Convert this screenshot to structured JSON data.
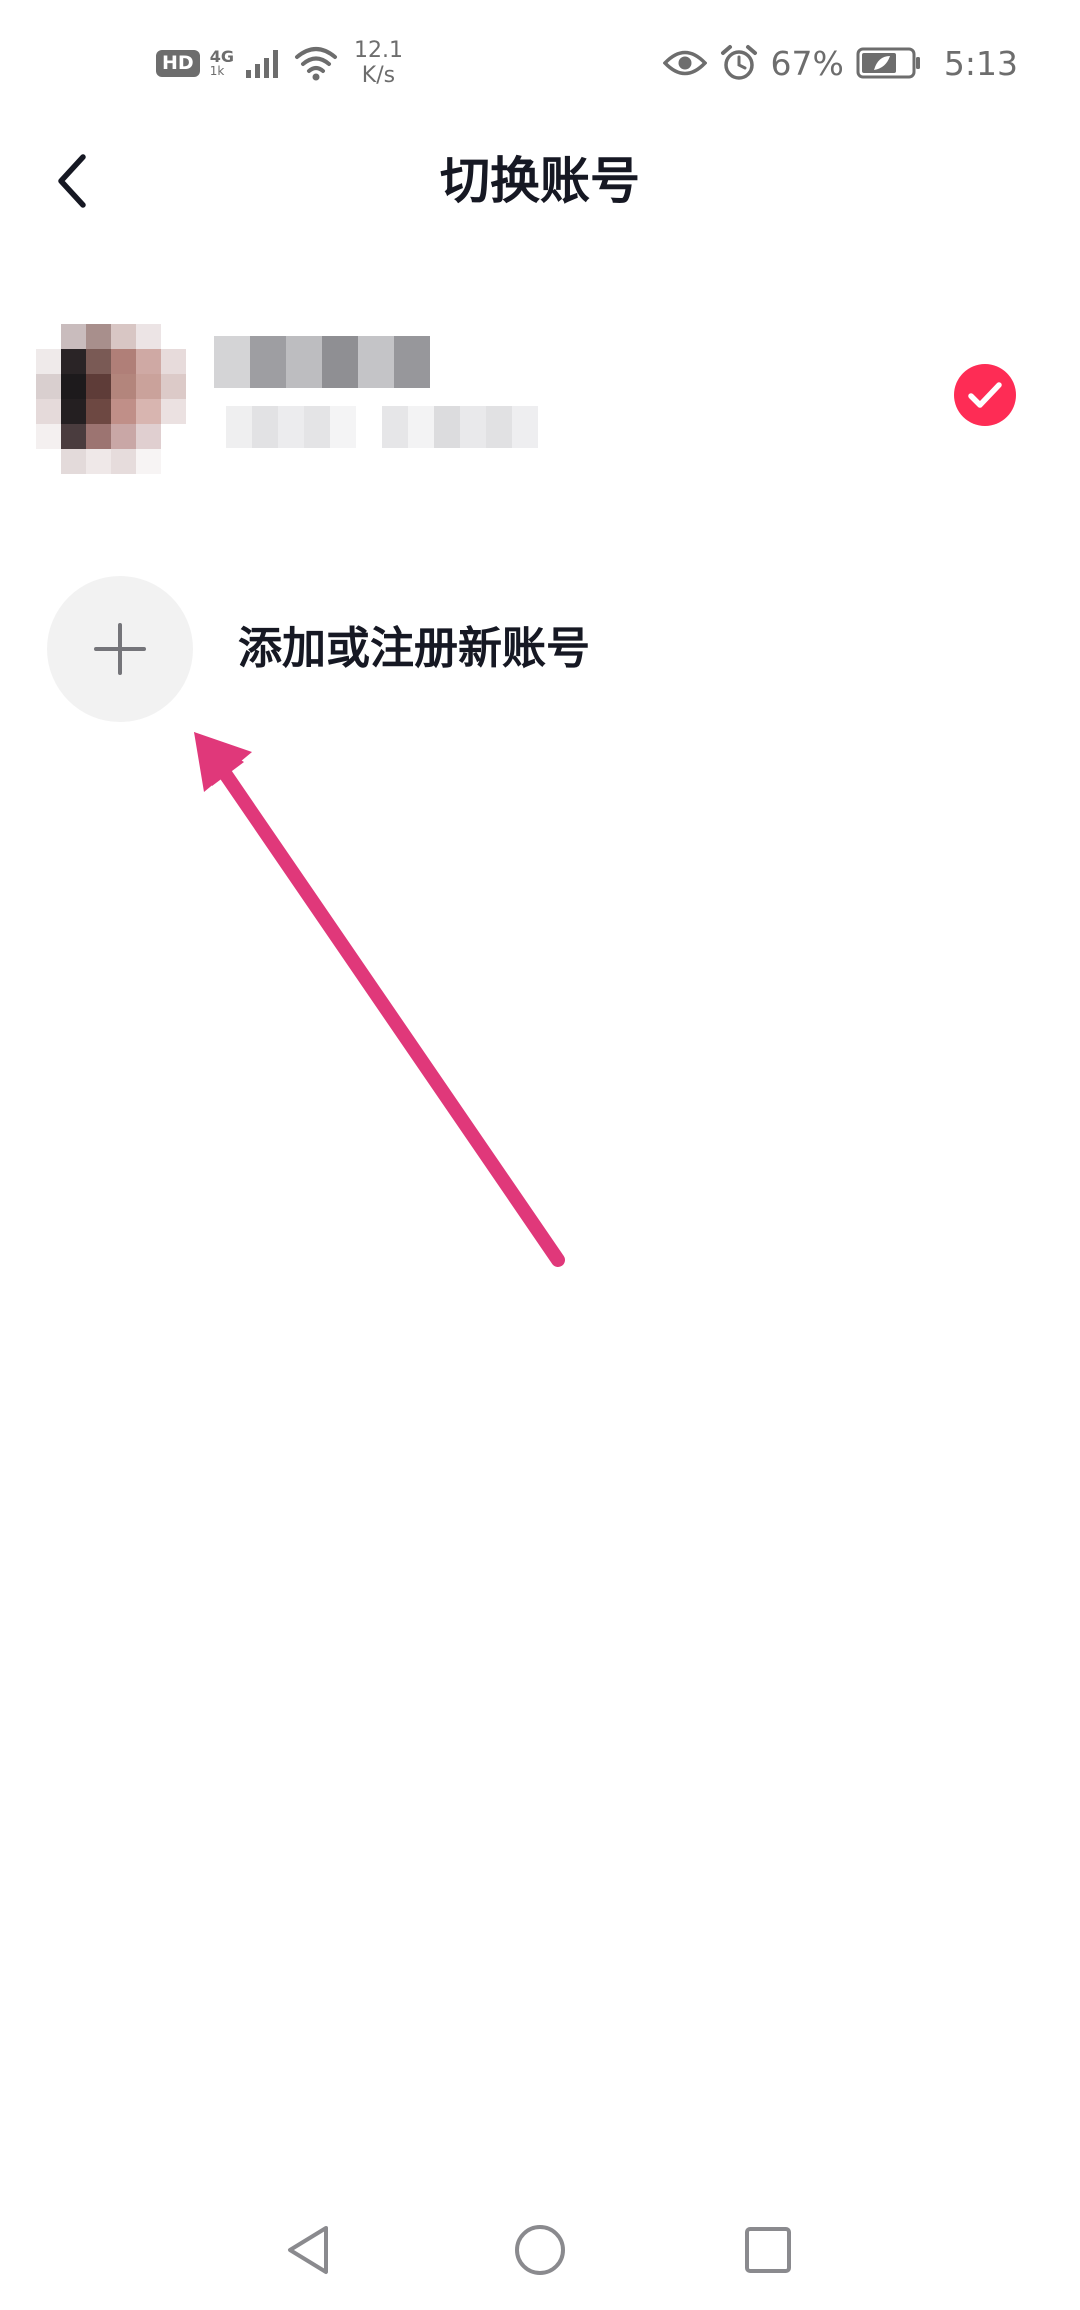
{
  "status_bar": {
    "hd_label": "HD",
    "network_type": "4G",
    "network_sub": "1k",
    "speed_value": "12.1",
    "speed_unit": "K/s",
    "battery_percent": "67%",
    "time": "5:13",
    "icons": [
      "signal-icon",
      "wifi-icon",
      "eye-icon",
      "alarm-icon",
      "battery-icon"
    ]
  },
  "header": {
    "back_icon": "chevron-left-icon",
    "title": "切换账号"
  },
  "current_account": {
    "avatar": "avatar-pixelated",
    "selected_icon": "check-circle-icon",
    "selected_color": "#fe2c55"
  },
  "add_account": {
    "icon": "plus-icon",
    "label": "添加或注册新账号"
  },
  "annotation": {
    "arrow_color": "#e0387a"
  },
  "nav_bar": {
    "icons": [
      "triangle-back-icon",
      "circle-home-icon",
      "square-recent-icon"
    ]
  }
}
